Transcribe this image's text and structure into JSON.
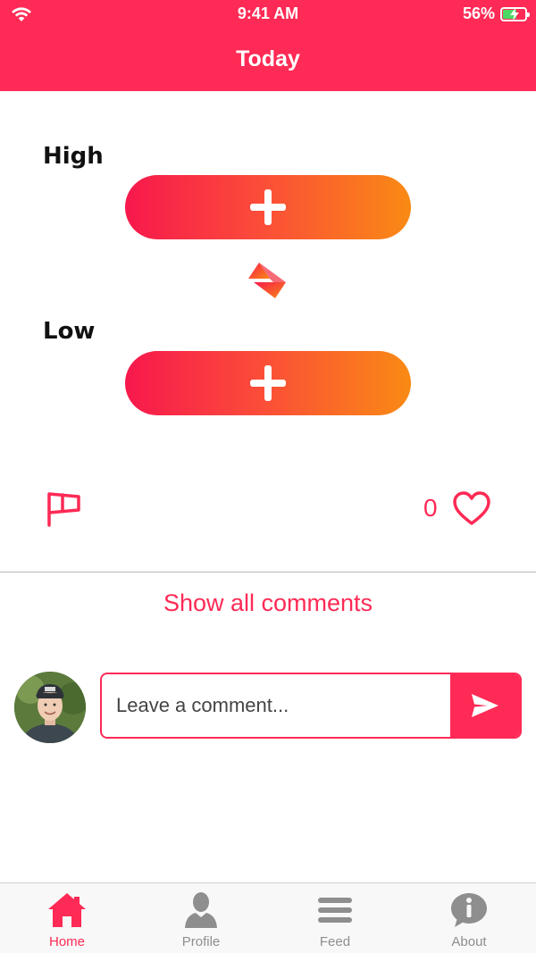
{
  "status_bar": {
    "time": "9:41 AM",
    "battery_percent": "56%",
    "battery_level": 0.56
  },
  "header": {
    "title": "Today"
  },
  "colors": {
    "accent": "#ff2a55",
    "gradient_start": "#f7184d",
    "gradient_end": "#f98a14",
    "inactive_tab": "#8e8e8e"
  },
  "content": {
    "high_label": "High",
    "low_label": "Low",
    "like_count": "0"
  },
  "comments": {
    "show_all_label": "Show all comments",
    "input_placeholder": "Leave a comment..."
  },
  "tabs": [
    {
      "label": "Home",
      "icon": "home-icon",
      "active": true
    },
    {
      "label": "Profile",
      "icon": "person-icon",
      "active": false
    },
    {
      "label": "Feed",
      "icon": "menu-icon",
      "active": false
    },
    {
      "label": "About",
      "icon": "info-bubble-icon",
      "active": false
    }
  ]
}
